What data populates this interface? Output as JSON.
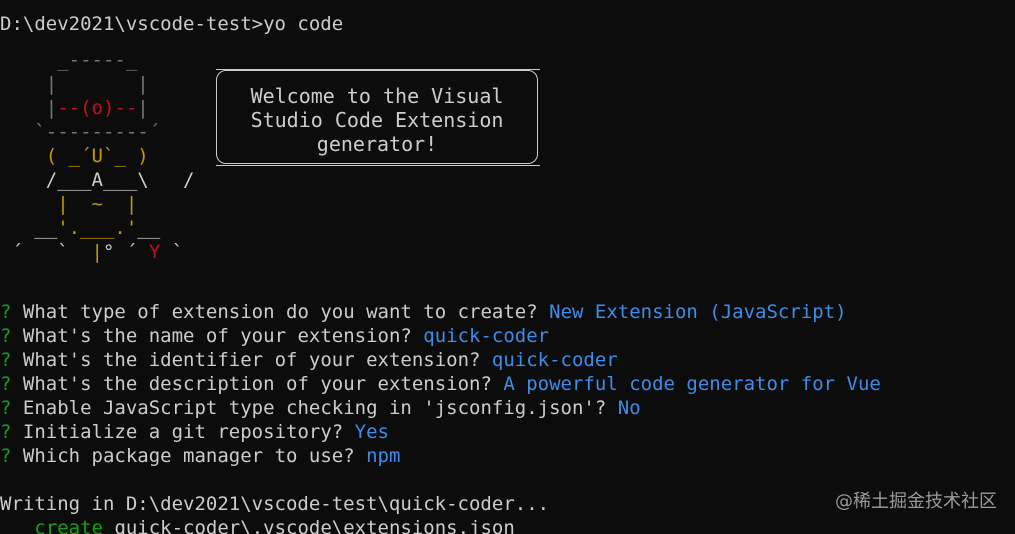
{
  "terminal": {
    "command_line": "D:\\dev2021\\vscode-test>yo code",
    "welcome": {
      "line1": "Welcome to the Visual",
      "line2": "Studio Code Extension",
      "line3": "generator!"
    },
    "prompts": [
      {
        "mark": "?",
        "question": "What type of extension do you want to create?",
        "answer": "New Extension (JavaScript)"
      },
      {
        "mark": "?",
        "question": "What's the name of your extension?",
        "answer": "quick-coder"
      },
      {
        "mark": "?",
        "question": "What's the identifier of your extension?",
        "answer": "quick-coder"
      },
      {
        "mark": "?",
        "question": "What's the description of your extension?",
        "answer": "A powerful code generator for Vue"
      },
      {
        "mark": "?",
        "question": "Enable JavaScript type checking in 'jsconfig.json'?",
        "answer": "No"
      },
      {
        "mark": "?",
        "question": "Initialize a git repository?",
        "answer": "Yes"
      },
      {
        "mark": "?",
        "question": "Which package manager to use?",
        "answer": "npm"
      }
    ],
    "writing_line": "Writing in D:\\dev2021\\vscode-test\\quick-coder...",
    "create_action": "create",
    "create_path": "quick-coder\\.vscode\\extensions.json",
    "watermark": "@稀土掘金技术社区"
  },
  "colors": {
    "background": "#0c0c0c",
    "text": "#cccccc",
    "question_mark": "#13a10e",
    "answer": "#3b8eea",
    "create": "#13a10e"
  }
}
